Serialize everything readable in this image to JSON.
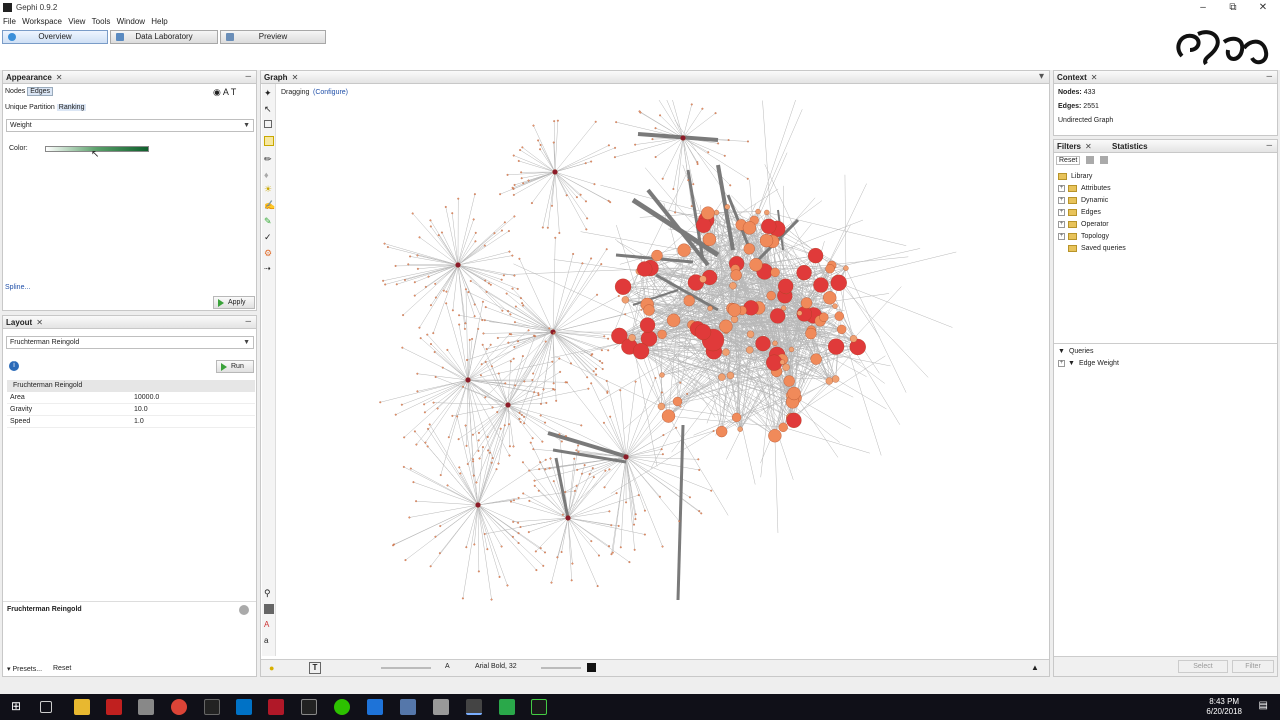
{
  "window": {
    "title": "Gephi 0.9.2"
  },
  "menu": [
    "File",
    "Workspace",
    "View",
    "Tools",
    "Window",
    "Help"
  ],
  "modes": [
    {
      "label": "Overview",
      "active": true
    },
    {
      "label": "Data Laboratory",
      "active": false
    },
    {
      "label": "Preview",
      "active": false
    }
  ],
  "appearance": {
    "tab": "Appearance",
    "target_tabs": [
      "Nodes",
      "Edges"
    ],
    "selected_target": "Edges",
    "sub_tabs": [
      "Unique",
      "Partition",
      "Ranking"
    ],
    "selected_sub_tab": "Ranking",
    "attribute": "Weight",
    "color_label": "Color:",
    "spline_link": "Spline...",
    "apply_label": "Apply",
    "gradient_colors": [
      "#ffffff",
      "#5aa06a",
      "#0f5f2c"
    ]
  },
  "layout": {
    "tab": "Layout",
    "algorithm": "Fruchterman Reingold",
    "run_label": "Run",
    "section_title": "Fruchterman Reingold",
    "properties": [
      {
        "name": "Area",
        "value": "10000.0"
      },
      {
        "name": "Gravity",
        "value": "10.0"
      },
      {
        "name": "Speed",
        "value": "1.0"
      }
    ],
    "description_title": "Fruchterman Reingold",
    "presets_label": "Presets...",
    "reset_label": "Reset"
  },
  "graph": {
    "tab": "Graph",
    "mode_label": "Dragging",
    "configure_label": "(Configure)",
    "font_label": "Arial Bold, 32"
  },
  "context": {
    "tab": "Context",
    "nodes_label": "Nodes:",
    "nodes_value": "433",
    "edges_label": "Edges:",
    "edges_value": "2551",
    "graph_type": "Undirected Graph"
  },
  "filters": {
    "tabs": [
      "Filters",
      "Statistics"
    ],
    "reset_label": "Reset",
    "library_label": "Library",
    "library_items": [
      "Attributes",
      "Dynamic",
      "Edges",
      "Operator",
      "Topology",
      "Saved queries"
    ],
    "queries_label": "Queries",
    "query_items": [
      "Edge Weight"
    ],
    "select_label": "Select",
    "filter_label": "Filter"
  },
  "taskbar": {
    "time": "8:43 PM",
    "date": "6/20/2018"
  },
  "colors": {
    "node_large": "#e03a3a",
    "node_medium": "#f08a5a",
    "node_small": "#f0a070",
    "node_dark": "#8b1a2a",
    "edge": "#b8b8b8",
    "edge_heavy": "#7a7a7a"
  }
}
